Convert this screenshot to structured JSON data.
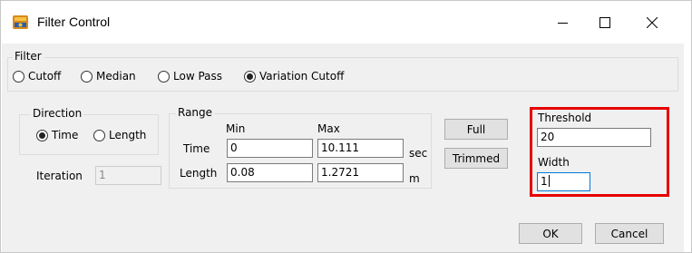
{
  "window": {
    "title": "Filter Control",
    "icon": "filter-app-icon",
    "controls": [
      "minimize-icon",
      "maximize-icon",
      "close-icon"
    ]
  },
  "filter": {
    "label": "Filter",
    "options": [
      {
        "label": "Cutoff",
        "selected": false
      },
      {
        "label": "Median",
        "selected": false
      },
      {
        "label": "Low Pass",
        "selected": false
      },
      {
        "label": "Variation Cutoff",
        "selected": true
      }
    ]
  },
  "direction": {
    "label": "Direction",
    "options": [
      {
        "label": "Time",
        "selected": true
      },
      {
        "label": "Length",
        "selected": false
      }
    ]
  },
  "iteration": {
    "label": "Iteration",
    "value": "1"
  },
  "range": {
    "label": "Range",
    "min_header": "Min",
    "max_header": "Max",
    "time": {
      "label": "Time",
      "min": "0",
      "max": "10.111",
      "unit": "sec"
    },
    "length": {
      "label": "Length",
      "min": "0.08",
      "max": "1.2721",
      "unit": "m"
    }
  },
  "buttons": {
    "full": "Full",
    "trimmed": "Trimmed",
    "ok": "OK",
    "cancel": "Cancel"
  },
  "threshold": {
    "label": "Threshold",
    "value": "20"
  },
  "width": {
    "label": "Width",
    "value": "1"
  },
  "colors": {
    "highlight": "#e60000",
    "focus": "#0078d7"
  }
}
